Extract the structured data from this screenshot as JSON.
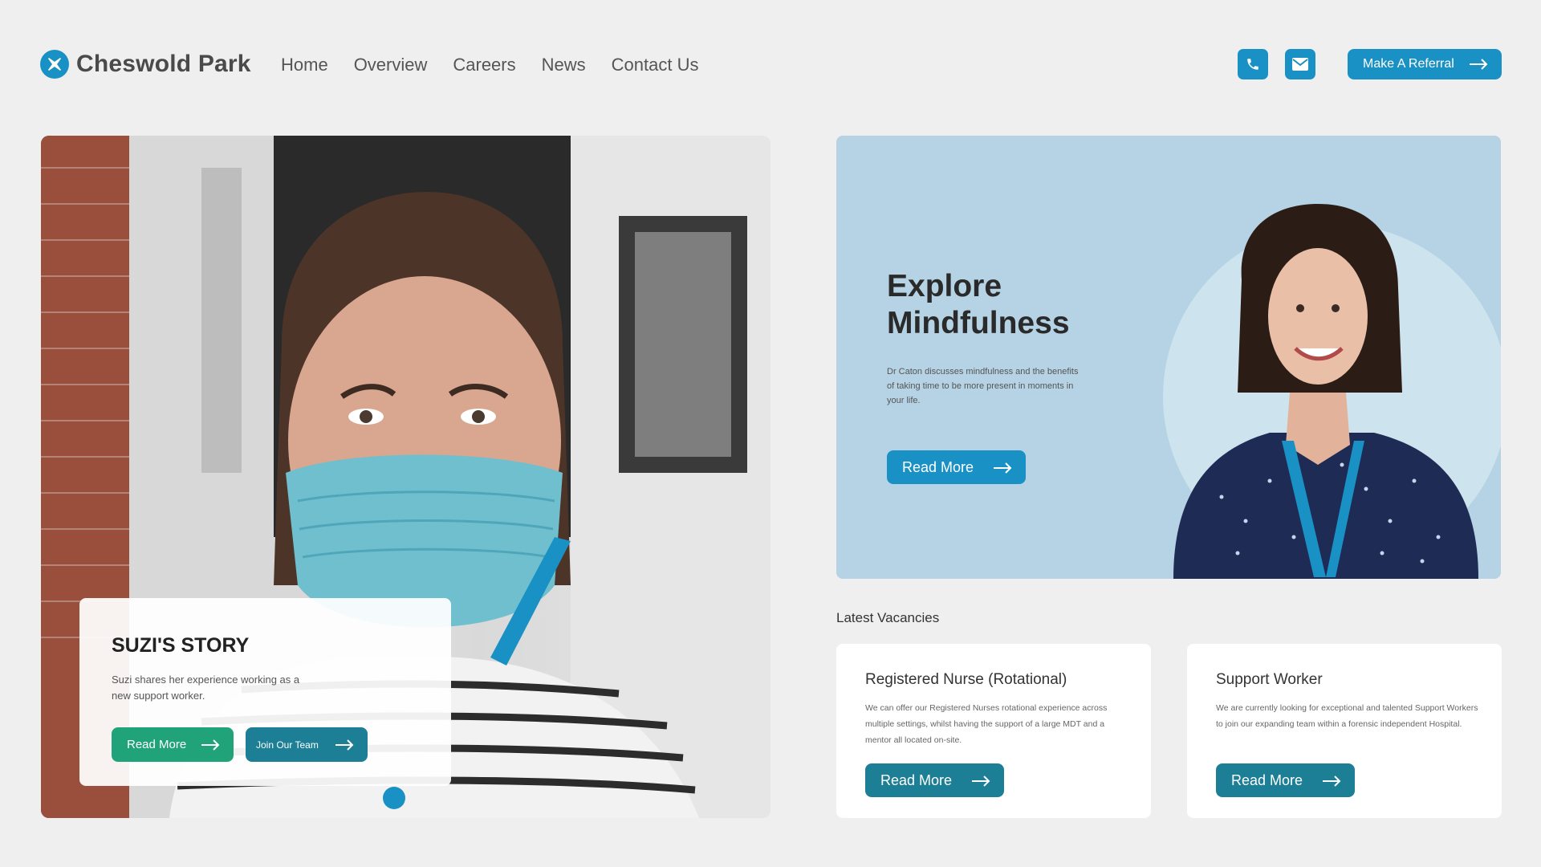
{
  "brand": {
    "name": "Cheswold Park",
    "accent": "#1a91c4",
    "green": "#21a37a",
    "teal": "#1c7f95",
    "feature_bg": "#b5d3e4"
  },
  "nav": {
    "items": [
      "Home",
      "Overview",
      "Careers",
      "News",
      "Contact Us"
    ]
  },
  "header": {
    "phone_icon": "phone-icon",
    "email_icon": "envelope-icon",
    "referral_label": "Make A Referral"
  },
  "hero": {
    "title": "SUZI'S STORY",
    "text": "Suzi shares her experience working as a new support worker.",
    "read_more": "Read More",
    "join_team": "Join Our Team"
  },
  "feature": {
    "title": "Explore Mindfulness",
    "text": "Dr Caton discusses mindfulness and the benefits of taking time to be more present in moments in your life.",
    "read_more": "Read More"
  },
  "vacancies": {
    "heading": "Latest Vacancies",
    "items": [
      {
        "title": "Registered Nurse (Rotational)",
        "text": "We can offer our Registered Nurses rotational experience across multiple settings, whilst having the support of a large MDT and a mentor all located on-site.",
        "button": "Read More"
      },
      {
        "title": "Support Worker",
        "text": "We are currently looking for exceptional and talented Support Workers to join our expanding team within a forensic independent Hospital.",
        "button": "Read More"
      }
    ]
  }
}
